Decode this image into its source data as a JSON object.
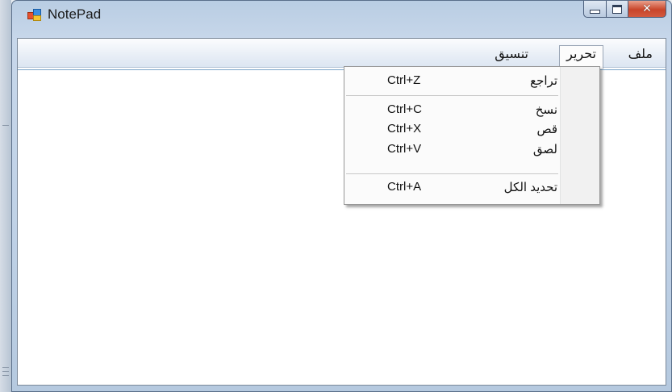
{
  "window": {
    "title": "NotePad",
    "icon": "app-icon",
    "buttons": [
      {
        "name": "minimize",
        "icon": "minimize-icon"
      },
      {
        "name": "maximize",
        "icon": "maximize-icon"
      },
      {
        "name": "close",
        "icon": "close-icon",
        "glyph": "✕"
      }
    ],
    "close_color": "#c8452a"
  },
  "menubar": {
    "file": "ملف",
    "edit": "تحرير",
    "format": "تنسيق"
  },
  "edit_menu": {
    "items": [
      {
        "label": "تراجع",
        "shortcut": "Ctrl+Z"
      },
      {
        "label": "نسخ",
        "shortcut": "Ctrl+C"
      },
      {
        "label": "قص",
        "shortcut": "Ctrl+X"
      },
      {
        "label": "لصق",
        "shortcut": "Ctrl+V"
      },
      {
        "label": "تحديد الكل",
        "shortcut": "Ctrl+A"
      }
    ]
  }
}
